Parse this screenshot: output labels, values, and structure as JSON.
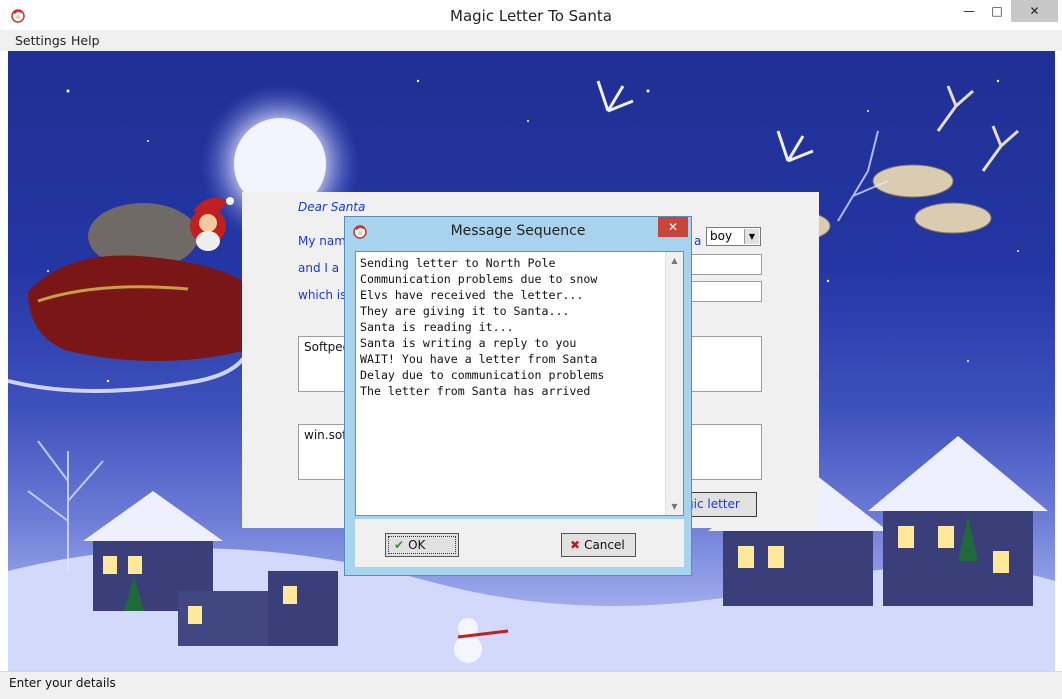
{
  "window": {
    "title": "Magic Letter To Santa",
    "minimize": "—",
    "maximize": "□",
    "close": "✕"
  },
  "menu": {
    "items": [
      "Settings",
      "Help"
    ]
  },
  "letter": {
    "greeting": "Dear Santa",
    "label_name": "My name",
    "label_and": "and I a",
    "label_which": "which is",
    "label_a": "a",
    "gender_value": "boy",
    "wish_text": "Softpec",
    "address_text": "win.sof",
    "send_button": "gic letter"
  },
  "dialog": {
    "title": "Message Sequence",
    "close": "✕",
    "messages": [
      "Sending letter to North Pole",
      "Communication problems due to snow",
      "Elvs have received the letter...",
      "They are giving it to Santa...",
      "Santa is reading it...",
      "Santa is writing a reply to you",
      "WAIT! You have a letter from Santa",
      "Delay due to communication problems",
      "The letter from Santa has arrived"
    ],
    "ok_label": "OK",
    "cancel_label": "Cancel"
  },
  "status": {
    "text": "Enter your details"
  },
  "colors": {
    "accent_blue": "#1a3ad8",
    "dialog_frame": "#a8d3ee",
    "close_red": "#c7453b",
    "ok_green": "#2a9a2a",
    "cancel_red": "#c41a1a"
  },
  "icons": {
    "app": "santa-icon",
    "ok": "checkmark-icon",
    "cancel": "x-mark-icon"
  }
}
